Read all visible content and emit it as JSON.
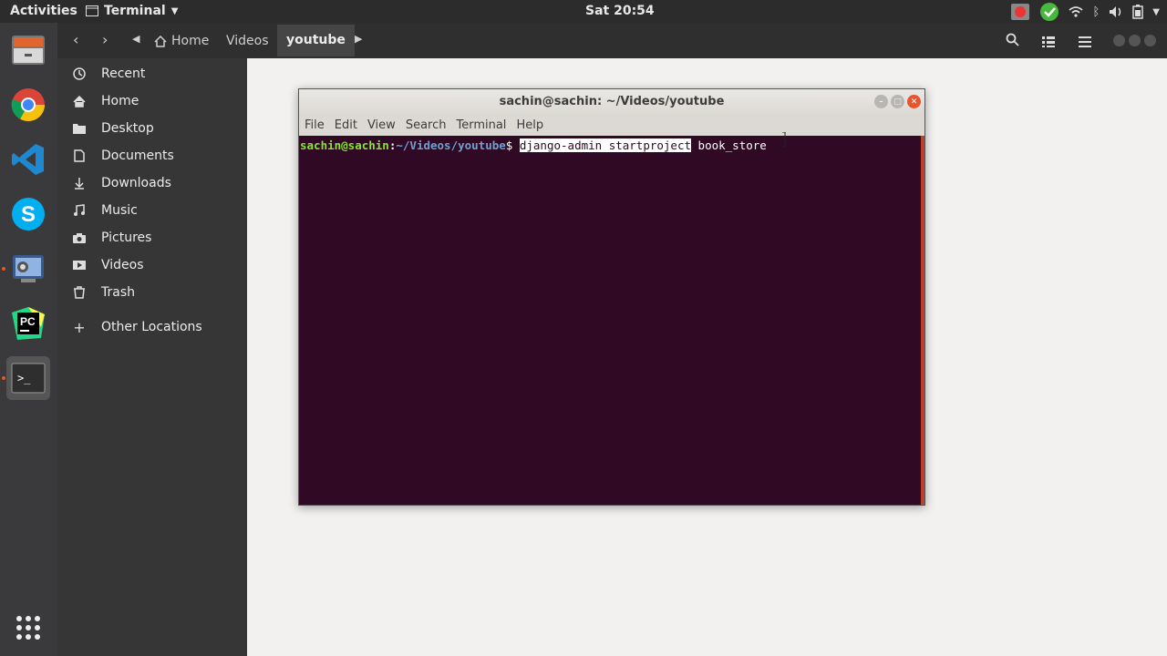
{
  "topbar": {
    "activities": "Activities",
    "app_menu": "Terminal",
    "clock": "Sat 20:54"
  },
  "dock": {
    "items": [
      "files-icon",
      "chrome-icon",
      "vscode-icon",
      "skype-icon",
      "screen-recorder-icon",
      "pycharm-icon",
      "terminal-icon",
      "app-grid-icon"
    ],
    "pycharm_label": "PC",
    "skype_label": "S"
  },
  "nautilus": {
    "breadcrumbs": [
      "Home",
      "Videos",
      "youtube"
    ],
    "sidebar": [
      {
        "label": "Recent",
        "icon": "clock-icon"
      },
      {
        "label": "Home",
        "icon": "home-icon"
      },
      {
        "label": "Desktop",
        "icon": "folder-icon"
      },
      {
        "label": "Documents",
        "icon": "document-icon"
      },
      {
        "label": "Downloads",
        "icon": "download-icon"
      },
      {
        "label": "Music",
        "icon": "music-icon"
      },
      {
        "label": "Pictures",
        "icon": "camera-icon"
      },
      {
        "label": "Videos",
        "icon": "video-icon"
      },
      {
        "label": "Trash",
        "icon": "trash-icon"
      },
      {
        "label": "Other Locations",
        "icon": "plus-icon"
      }
    ]
  },
  "terminal": {
    "title": "sachin@sachin: ~/Videos/youtube",
    "menu": [
      "File",
      "Edit",
      "View",
      "Search",
      "Terminal",
      "Help"
    ],
    "prompt_user": "sachin@sachin",
    "prompt_path": "~/Videos/youtube",
    "prompt_symbol": "$",
    "command_selected": "django-admin startproject",
    "command_rest": " book_store"
  },
  "colors": {
    "terminal_bg": "#300a24",
    "prompt_user": "#8ae234",
    "prompt_path": "#729fcf",
    "accent": "#e95420"
  }
}
